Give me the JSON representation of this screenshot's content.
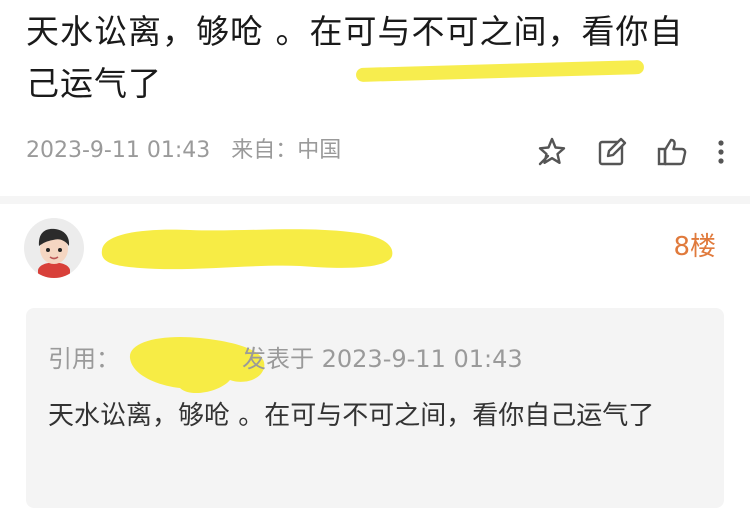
{
  "post": {
    "content": "天水讼离，够呛 。在可与不可之间，看你自己运气了",
    "date": "2023-9-11 01:43",
    "source": "来自：中国"
  },
  "icons": {
    "star": "star-outline-icon",
    "edit": "edit-icon",
    "like": "thumbs-up-icon",
    "more": "more-vertical-icon"
  },
  "reply": {
    "floor": "8楼",
    "quote_prefix": "引用：",
    "quote_posted_at": "发表于 2023-9-11 01:43",
    "quote_text": "天水讼离，够呛 。在可与不可之间，看你自己运气了"
  },
  "colors": {
    "accent": "#e07a3c",
    "highlighter": "#f7ec45",
    "meta_text": "#9a9a9a"
  }
}
